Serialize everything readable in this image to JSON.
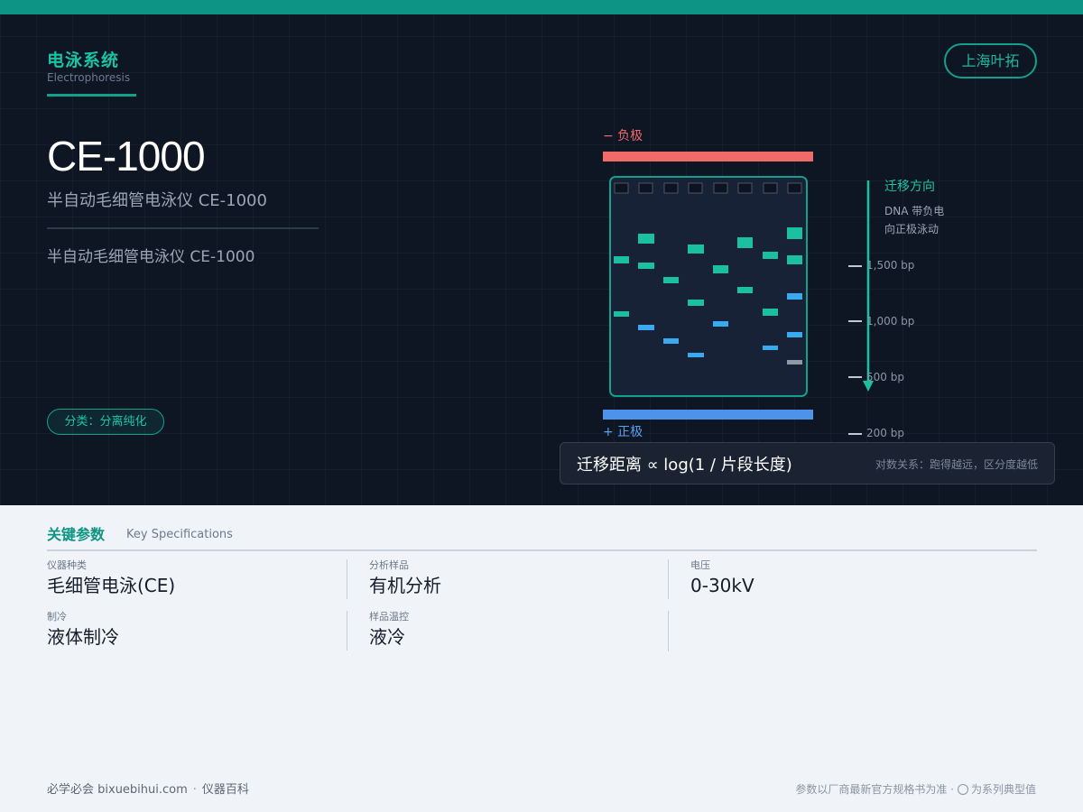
{
  "category": {
    "title": "电泳系统",
    "subtitle": "Electrophoresis"
  },
  "brand": "上海叶拓",
  "product": {
    "model": "CE-1000",
    "name": "半自动毛细管电泳仪 CE-1000",
    "description": "半自动毛细管电泳仪 CE-1000",
    "classification": "分类：分离纯化"
  },
  "diagram": {
    "negative_label": "− 负极",
    "positive_label": "+ 正极",
    "direction_title": "迁移方向",
    "direction_note_1": "DNA 带负电",
    "direction_note_2": "向正极泳动",
    "ladder": [
      "1,500 bp",
      "1,000 bp",
      "500 bp",
      "200 bp"
    ],
    "colors": {
      "negative": "#f06a6a",
      "positive": "#4d93ea",
      "band_teal": "#1bbfa2",
      "band_blue": "#3aaaf0",
      "band_gray": "#8e99a8",
      "gel": "#182236",
      "gel_border": "#12a08e"
    }
  },
  "formula": {
    "main": "迁移距离 ∝ log(1 / 片段长度)",
    "note": "对数关系：跑得越远，区分度越低"
  },
  "specs": {
    "title": "关键参数",
    "title_en": "Key Specifications",
    "items": [
      {
        "label": "仪器种类",
        "value": "毛细管电泳(CE)"
      },
      {
        "label": "分析样品",
        "value": "有机分析"
      },
      {
        "label": "电压",
        "value": "0-30kV"
      },
      {
        "label": "制冷",
        "value": "液体制冷"
      },
      {
        "label": "样品温控",
        "value": "液冷"
      }
    ]
  },
  "footer": {
    "site": "必学必会 bixuebihui.com",
    "sep": "·",
    "section": "仪器百科",
    "note_1": "参数以厂商最新官方规格书为准 ·",
    "note_2": "为系列典型值"
  }
}
